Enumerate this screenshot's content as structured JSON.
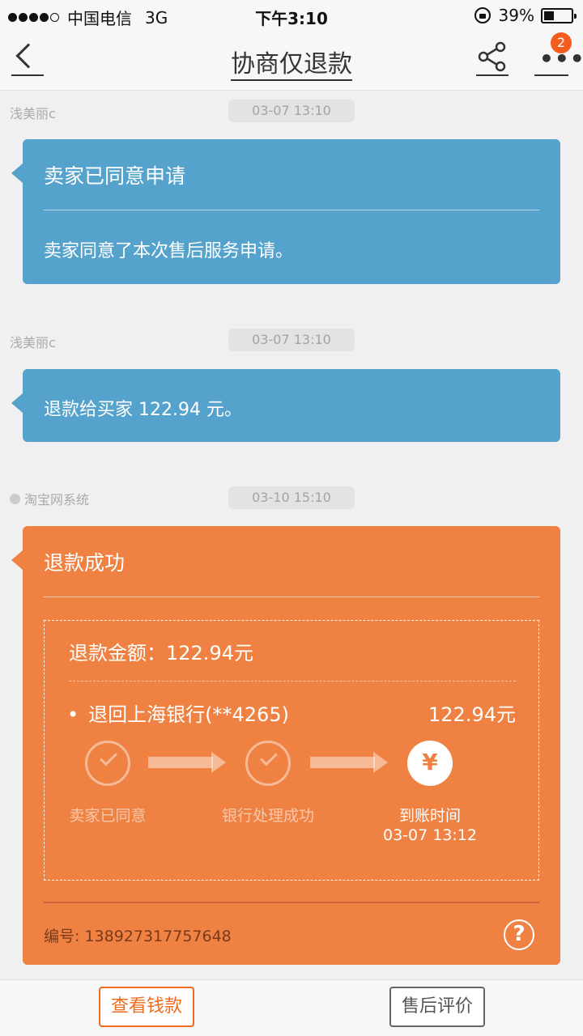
{
  "status_bar": {
    "carrier": "中国电信",
    "network": "3G",
    "time": "下午3:10",
    "battery": "39%",
    "battery_level": 0.39
  },
  "nav": {
    "title": "协商仅退款",
    "notification_count": "2",
    "icons": [
      "back-icon",
      "share-icon",
      "more-icon"
    ]
  },
  "messages": [
    {
      "sender": "浅美丽c",
      "time": "03-07 13:10",
      "title": "卖家已同意申请",
      "body": "卖家同意了本次售后服务申请。",
      "color": "#55a3cd"
    },
    {
      "sender": "浅美丽c",
      "time": "03-07 13:10",
      "body": "退款给买家 122.94 元。",
      "color": "#55a3cd"
    },
    {
      "sender": "淘宝网系统",
      "time": "03-10 15:10",
      "title": "退款成功",
      "amount_label": "退款金额：",
      "amount": "122.94元",
      "bank_label": "退回上海银行(**4265)",
      "bank_amount": "122.94元",
      "steps": [
        {
          "label": "卖家已同意",
          "status": "done",
          "icon": "check-icon"
        },
        {
          "label": "银行处理成功",
          "status": "done",
          "icon": "check-icon"
        },
        {
          "label": "到账时间",
          "sublabel": "03-07 13:12",
          "status": "current",
          "icon": "yen-icon",
          "glyph": "¥"
        }
      ],
      "serial": "编号: 138927317757648",
      "color": "#ef8243"
    }
  ],
  "bottom_bar": {
    "view_money_label": "查看钱款",
    "review_label": "售后评价"
  },
  "colors": {
    "accent": "#ef6b1e",
    "blue_card": "#55a3cd",
    "orange_card": "#ef8243"
  }
}
